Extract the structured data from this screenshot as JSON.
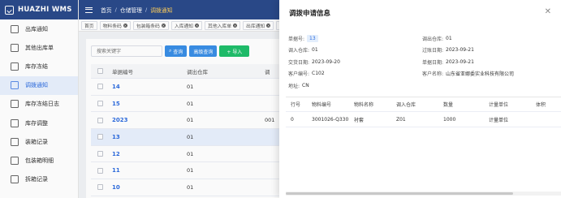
{
  "app": {
    "title": "HUAZHI WMS"
  },
  "sidebar": {
    "items": [
      {
        "label": "出库通知",
        "icon": "export-icon"
      },
      {
        "label": "其他出库单",
        "icon": "truck-icon"
      },
      {
        "label": "库存冻结",
        "icon": "lock-icon"
      },
      {
        "label": "调拨通知",
        "icon": "transfer-icon",
        "active": true
      },
      {
        "label": "库存冻结日志",
        "icon": "log-icon"
      },
      {
        "label": "库存调整",
        "icon": "adjust-icon"
      },
      {
        "label": "装箱记录",
        "icon": "box-icon"
      },
      {
        "label": "包装箱明细",
        "icon": "package-icon"
      },
      {
        "label": "拆箱记录",
        "icon": "unbox-icon"
      }
    ]
  },
  "header": {
    "breadcrumb": [
      "首页",
      "仓储管理",
      "调拨通知"
    ]
  },
  "tabs": [
    {
      "label": "首页",
      "closable": false
    },
    {
      "label": "物料条码",
      "closable": true
    },
    {
      "label": "包装箱条码",
      "closable": true
    },
    {
      "label": "入库通知",
      "closable": true
    },
    {
      "label": "其他入库单",
      "closable": true
    },
    {
      "label": "出库通知",
      "closable": true
    },
    {
      "label": "其",
      "closable": false
    }
  ],
  "list": {
    "search_placeholder": "搜索关键字",
    "search_label": "查询",
    "advanced_label": "高级查询",
    "add_label": "+ 导入",
    "columns": [
      "单据编号",
      "调出仓库",
      "调"
    ],
    "rows": [
      {
        "no": "14",
        "out_wh": "01",
        "more": ""
      },
      {
        "no": "15",
        "out_wh": "01",
        "more": ""
      },
      {
        "no": "2023",
        "out_wh": "01",
        "more": "001"
      },
      {
        "no": "13",
        "out_wh": "01",
        "more": "",
        "selected": true
      },
      {
        "no": "12",
        "out_wh": "01",
        "more": ""
      },
      {
        "no": "11",
        "out_wh": "01",
        "more": ""
      },
      {
        "no": "10",
        "out_wh": "01",
        "more": ""
      }
    ]
  },
  "drawer": {
    "title": "调拨申请信息",
    "fields": [
      {
        "label": "单据号:",
        "value": "13",
        "badge": true
      },
      {
        "label": "调出仓库:",
        "value": "01"
      },
      {
        "label": "调入仓库:",
        "value": "01"
      },
      {
        "label": "过账日期:",
        "value": "2023-09-21"
      },
      {
        "label": "交货日期:",
        "value": "2023-09-20"
      },
      {
        "label": "单据日期:",
        "value": "2023-09-21"
      },
      {
        "label": "客户编号:",
        "value": "C102"
      },
      {
        "label": "客户名称:",
        "value": "山东省亚娜委实业科技有限公司"
      },
      {
        "label": "地址:",
        "value": "CN"
      }
    ],
    "table": {
      "columns": [
        "行号",
        "物料编号",
        "物料名称",
        "调入仓库",
        "数量",
        "计量单位",
        "体积"
      ],
      "rows": [
        [
          "0",
          "3001026-Q3301",
          "衬套",
          "Z01",
          "1000",
          "计量单位",
          ""
        ]
      ]
    }
  }
}
